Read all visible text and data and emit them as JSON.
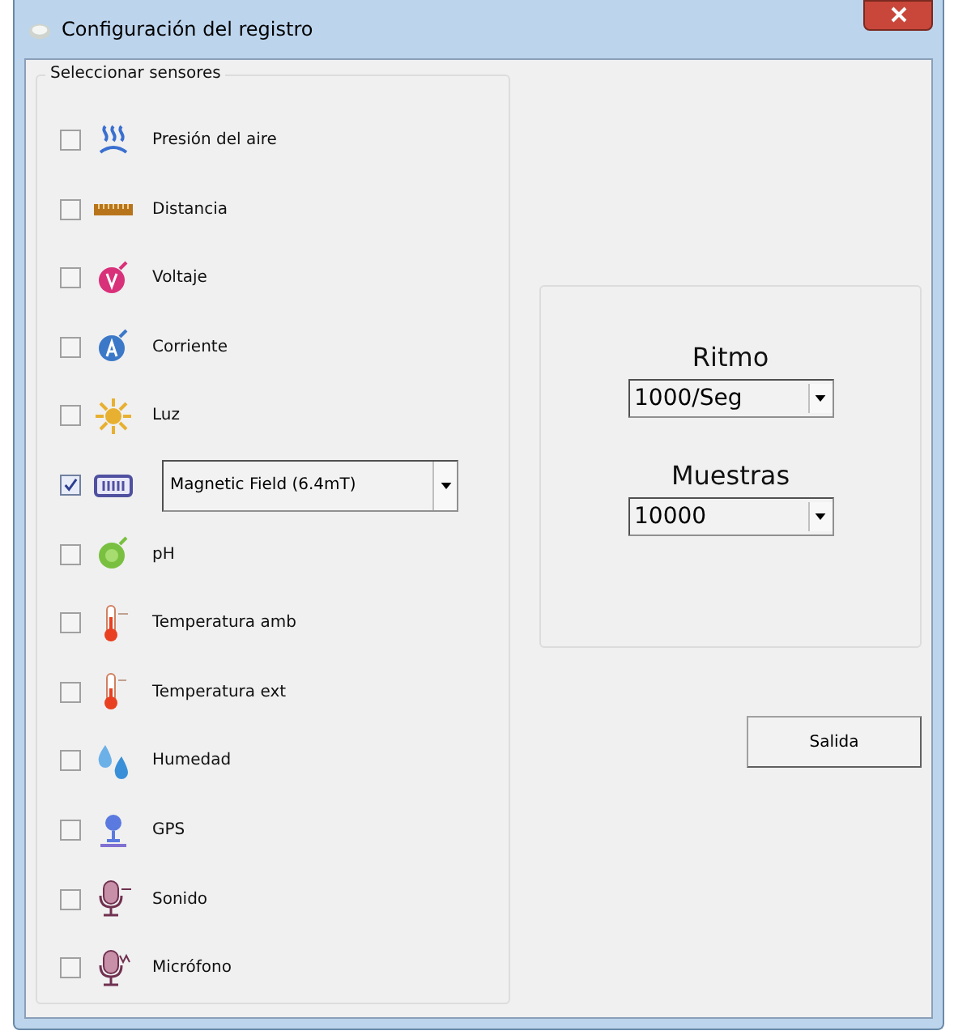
{
  "window": {
    "title": "Configuración del registro"
  },
  "sensors": {
    "title": "Seleccionar sensores",
    "items": [
      {
        "kind": "plain",
        "label": "Presión del aire",
        "checked": false
      },
      {
        "kind": "plain",
        "label": "Distancia",
        "checked": false
      },
      {
        "kind": "plain",
        "label": "Voltaje",
        "checked": false
      },
      {
        "kind": "plain",
        "label": "Corriente",
        "checked": false
      },
      {
        "kind": "plain",
        "label": "Luz",
        "checked": false
      },
      {
        "kind": "select",
        "value": "Magnetic Field (6.4mT)",
        "checked": true
      },
      {
        "kind": "plain",
        "label": "pH",
        "checked": false
      },
      {
        "kind": "plain",
        "label": "Temperatura amb",
        "checked": false
      },
      {
        "kind": "plain",
        "label": "Temperatura ext",
        "checked": false
      },
      {
        "kind": "plain",
        "label": "Humedad",
        "checked": false
      },
      {
        "kind": "plain",
        "label": "GPS",
        "checked": false
      },
      {
        "kind": "plain",
        "label": "Sonido",
        "checked": false
      },
      {
        "kind": "plain",
        "label": "Micrófono",
        "checked": false
      }
    ]
  },
  "settings": [
    {
      "label": "Ritmo",
      "value": "1000/Seg"
    },
    {
      "label": "Muestras",
      "value": "10000"
    }
  ],
  "buttons": [
    "Salida"
  ]
}
